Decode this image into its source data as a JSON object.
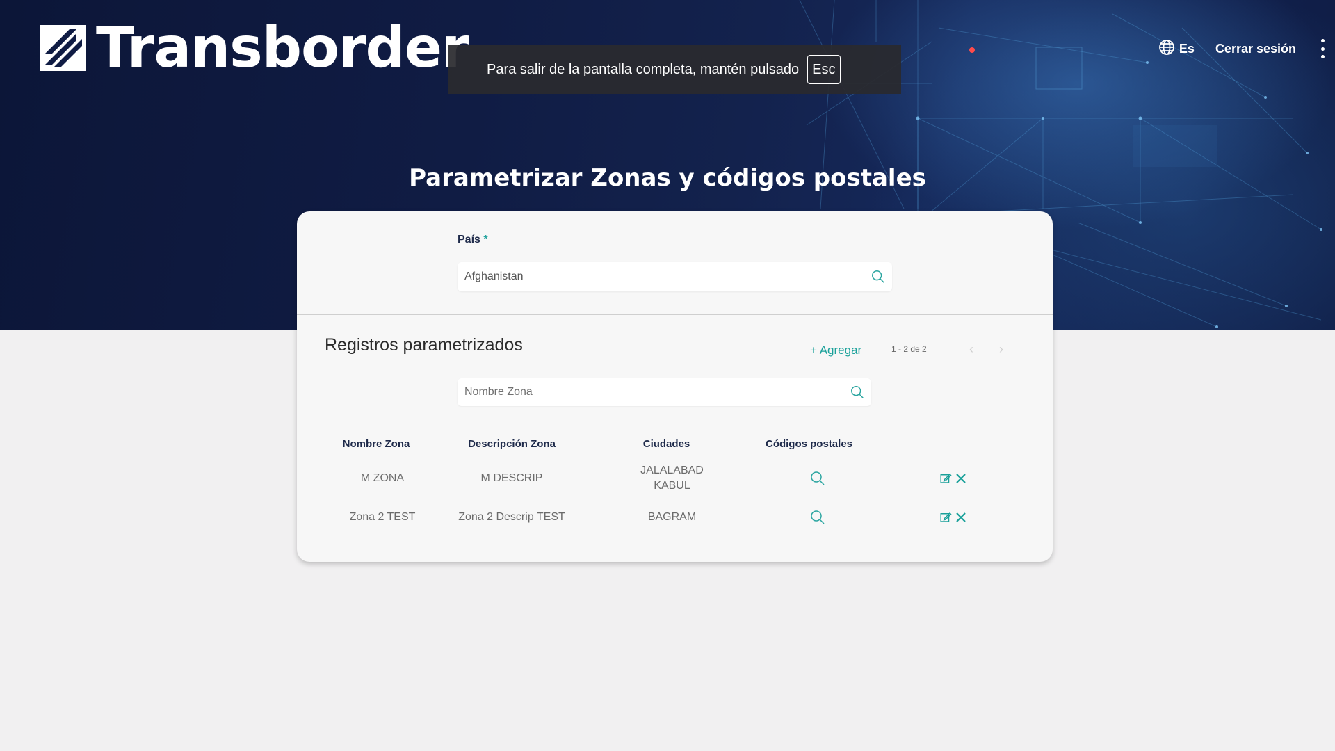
{
  "header": {
    "brand": "Transborder",
    "language": "Es",
    "logout_label": "Cerrar sesión"
  },
  "fullscreen_notice": {
    "text": "Para salir de la pantalla completa, mantén pulsado",
    "key": "Esc"
  },
  "page": {
    "title": "Parametrizar Zonas y códigos postales"
  },
  "country": {
    "label": "País",
    "required_mark": "*",
    "value": "Afghanistan"
  },
  "records": {
    "title": "Registros parametrizados",
    "add_label": "+ Agregar",
    "pagination": "1 - 2 de 2",
    "search_placeholder": "Nombre Zona",
    "columns": [
      "Nombre Zona",
      "Descripción Zona",
      "Ciudades",
      "Códigos postales"
    ],
    "rows": [
      {
        "name": "M ZONA",
        "description": "M DESCRIP",
        "cities": [
          "JALALABAD",
          "KABUL"
        ]
      },
      {
        "name": "Zona 2 TEST",
        "description": "Zona 2 Descrip TEST",
        "cities": [
          "BAGRAM"
        ]
      }
    ]
  },
  "colors": {
    "accent": "#1aa19a",
    "header_bg": "#0f1c44",
    "heading_text": "#1e2a4a"
  },
  "icons": {
    "search": "search-icon",
    "edit": "edit-icon",
    "delete": "close-icon",
    "language": "globe-icon",
    "menu": "kebab-menu-icon"
  }
}
